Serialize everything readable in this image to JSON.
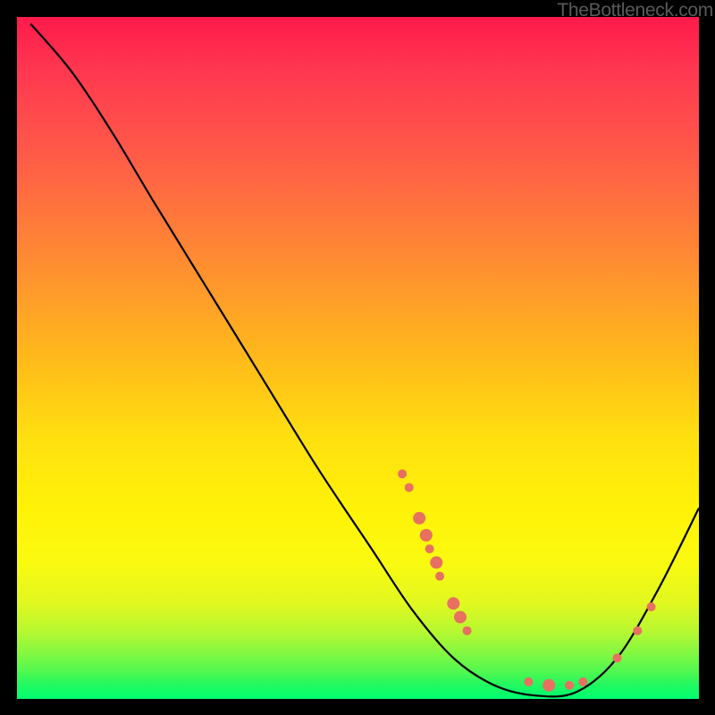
{
  "watermark": "TheBottleneck.com",
  "chart_data": {
    "type": "line",
    "title": "",
    "xlabel": "",
    "ylabel": "",
    "xlim": [
      0,
      100
    ],
    "ylim": [
      0,
      100
    ],
    "grid": false,
    "series": [
      {
        "name": "curve",
        "type": "line",
        "color": "#000000",
        "points": [
          {
            "x": 2,
            "y": 99
          },
          {
            "x": 8,
            "y": 92
          },
          {
            "x": 14,
            "y": 83
          },
          {
            "x": 20,
            "y": 73
          },
          {
            "x": 28,
            "y": 60
          },
          {
            "x": 36,
            "y": 47
          },
          {
            "x": 44,
            "y": 34
          },
          {
            "x": 52,
            "y": 22
          },
          {
            "x": 58,
            "y": 13
          },
          {
            "x": 64,
            "y": 6
          },
          {
            "x": 70,
            "y": 2
          },
          {
            "x": 76,
            "y": 0.5
          },
          {
            "x": 82,
            "y": 1
          },
          {
            "x": 88,
            "y": 6
          },
          {
            "x": 94,
            "y": 16
          },
          {
            "x": 100,
            "y": 28
          }
        ]
      },
      {
        "name": "dots",
        "type": "scatter",
        "color": "#e87060",
        "points": [
          {
            "x": 56.5,
            "y": 33,
            "r": 5
          },
          {
            "x": 57.5,
            "y": 31,
            "r": 5
          },
          {
            "x": 59,
            "y": 26.5,
            "r": 7
          },
          {
            "x": 60,
            "y": 24,
            "r": 7
          },
          {
            "x": 60.5,
            "y": 22,
            "r": 5
          },
          {
            "x": 61.5,
            "y": 20,
            "r": 7
          },
          {
            "x": 62,
            "y": 18,
            "r": 5
          },
          {
            "x": 64,
            "y": 14,
            "r": 7
          },
          {
            "x": 65,
            "y": 12,
            "r": 7
          },
          {
            "x": 66,
            "y": 10,
            "r": 5
          },
          {
            "x": 75,
            "y": 2.5,
            "r": 5
          },
          {
            "x": 78,
            "y": 2,
            "r": 7
          },
          {
            "x": 81,
            "y": 2,
            "r": 5
          },
          {
            "x": 83,
            "y": 2.5,
            "r": 5
          },
          {
            "x": 88,
            "y": 6,
            "r": 5
          },
          {
            "x": 91,
            "y": 10,
            "r": 5
          },
          {
            "x": 93,
            "y": 13.5,
            "r": 5
          }
        ]
      }
    ]
  }
}
